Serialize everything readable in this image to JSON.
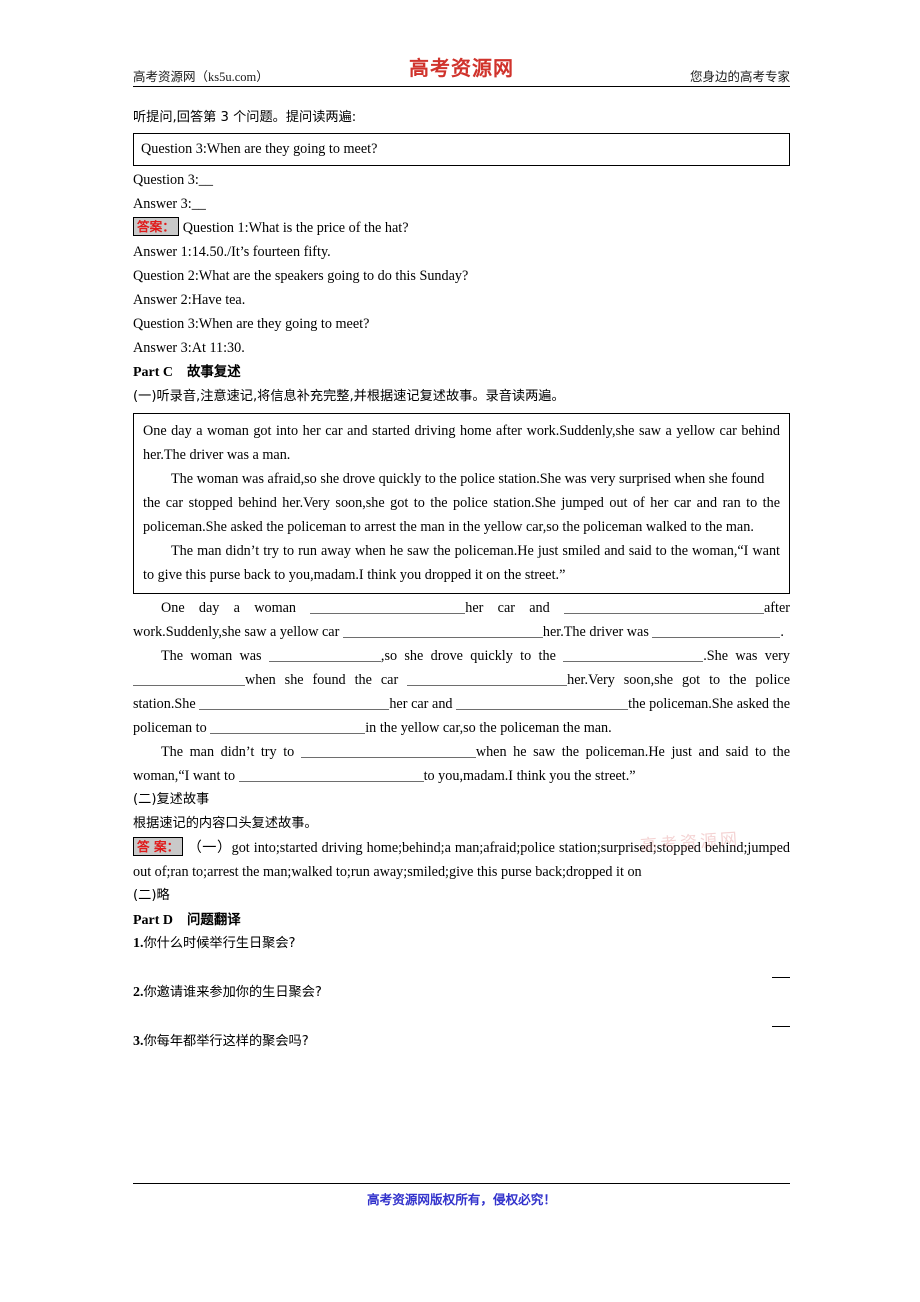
{
  "header": {
    "left": "高考资源网（ks5u.com）",
    "center": "高考资源网",
    "right": "您身边的高考专家"
  },
  "intro": {
    "instruction": "听提问,回答第 3 个问题。提问读两遍:"
  },
  "question_box": {
    "text": "Question 3:When are they going to meet?"
  },
  "blanks": {
    "q3": "Question 3:__",
    "a3": "Answer 3:__"
  },
  "answer_badge": {
    "label": "答案："
  },
  "answer_badge_spaced": {
    "label": "答 案："
  },
  "listening_answers": [
    "Question 1:What is the price of the hat?",
    "Answer 1:14.50./It’s fourteen fifty.",
    "Question 2:What are the speakers going to do this Sunday?",
    "Answer 2:Have tea.",
    "Question 3:When are they going to meet?",
    "Answer 3:At 11:30."
  ],
  "part_c": {
    "label": "Part C",
    "title": "故事复述",
    "instruction": "(一)听录音,注意速记,将信息补充完整,并根据速记复述故事。录音读两遍。"
  },
  "story": {
    "p1": "One day a woman got into her car and started driving home after work.Suddenly,she saw a yellow car behind her.The driver was a man.",
    "p2a": "The woman was afraid,so she drove quickly to the police station.She was very surprised when she found",
    "p2b": "the car stopped behind her.Very soon,she got to the police station.She jumped out of her car and ran to the policeman.She asked the policeman to arrest the man in the yellow car,so the policeman walked to the man.",
    "p3": "The man didn’t try to run away when he saw the policeman.He just smiled and said to the woman,“I want to give this purse back to you,madam.I think you dropped it on the street.”"
  },
  "fill_in": {
    "seg1": "One day a woman ",
    "seg2": "her car and ",
    "seg3": "after work.Suddenly,she saw a yellow car ",
    "seg4": "her.The driver was ",
    "seg5": ".",
    "seg6": "The woman was ",
    "seg7": ",so she drove quickly to the ",
    "seg8": ".She was very ",
    "seg9": "when she found the car ",
    "seg10": "her.Very soon,she got to the police station.She ",
    "seg11": "her car and ",
    "seg12": "the policeman.She asked the policeman to ",
    "seg13": "in the yellow car,so the policeman ",
    "seg14": "the man.",
    "seg15": "The man didn’t try to ",
    "seg16": "when he saw the policeman.He just ",
    "seg17": "and said to the woman,“I want to ",
    "seg18": "to you,madam.I think you ",
    "seg19": "the street.”"
  },
  "retell": {
    "heading": "(二)复述故事",
    "instruction": "根据速记的内容口头复述故事。",
    "answer_prefix": "（一）",
    "answer_text": "got into;started driving home;behind;a man;afraid;police station;surprised;stopped behind;jumped out of;ran to;arrest the man;walked to;run away;smiled;give this purse back;dropped it on",
    "answer_two": "(二)略"
  },
  "part_d": {
    "label": "Part D",
    "title": "问题翻译",
    "questions": [
      {
        "num": "1.",
        "text": "你什么时候举行生日聚会?"
      },
      {
        "num": "2.",
        "text": "你邀请谁来参加你的生日聚会?"
      },
      {
        "num": "3.",
        "text": "你每年都举行这样的聚会吗?"
      }
    ]
  },
  "watermark": {
    "text": "高考资源网"
  },
  "footer": {
    "text": "高考资源网版权所有，侵权必究！"
  },
  "colors": {
    "brand_red": "#d0332c",
    "badge_red": "#e01b1b",
    "badge_bg": "#c9c9c9",
    "footer_blue": "#3333cc",
    "blank_gray": "#6e6e6e"
  }
}
